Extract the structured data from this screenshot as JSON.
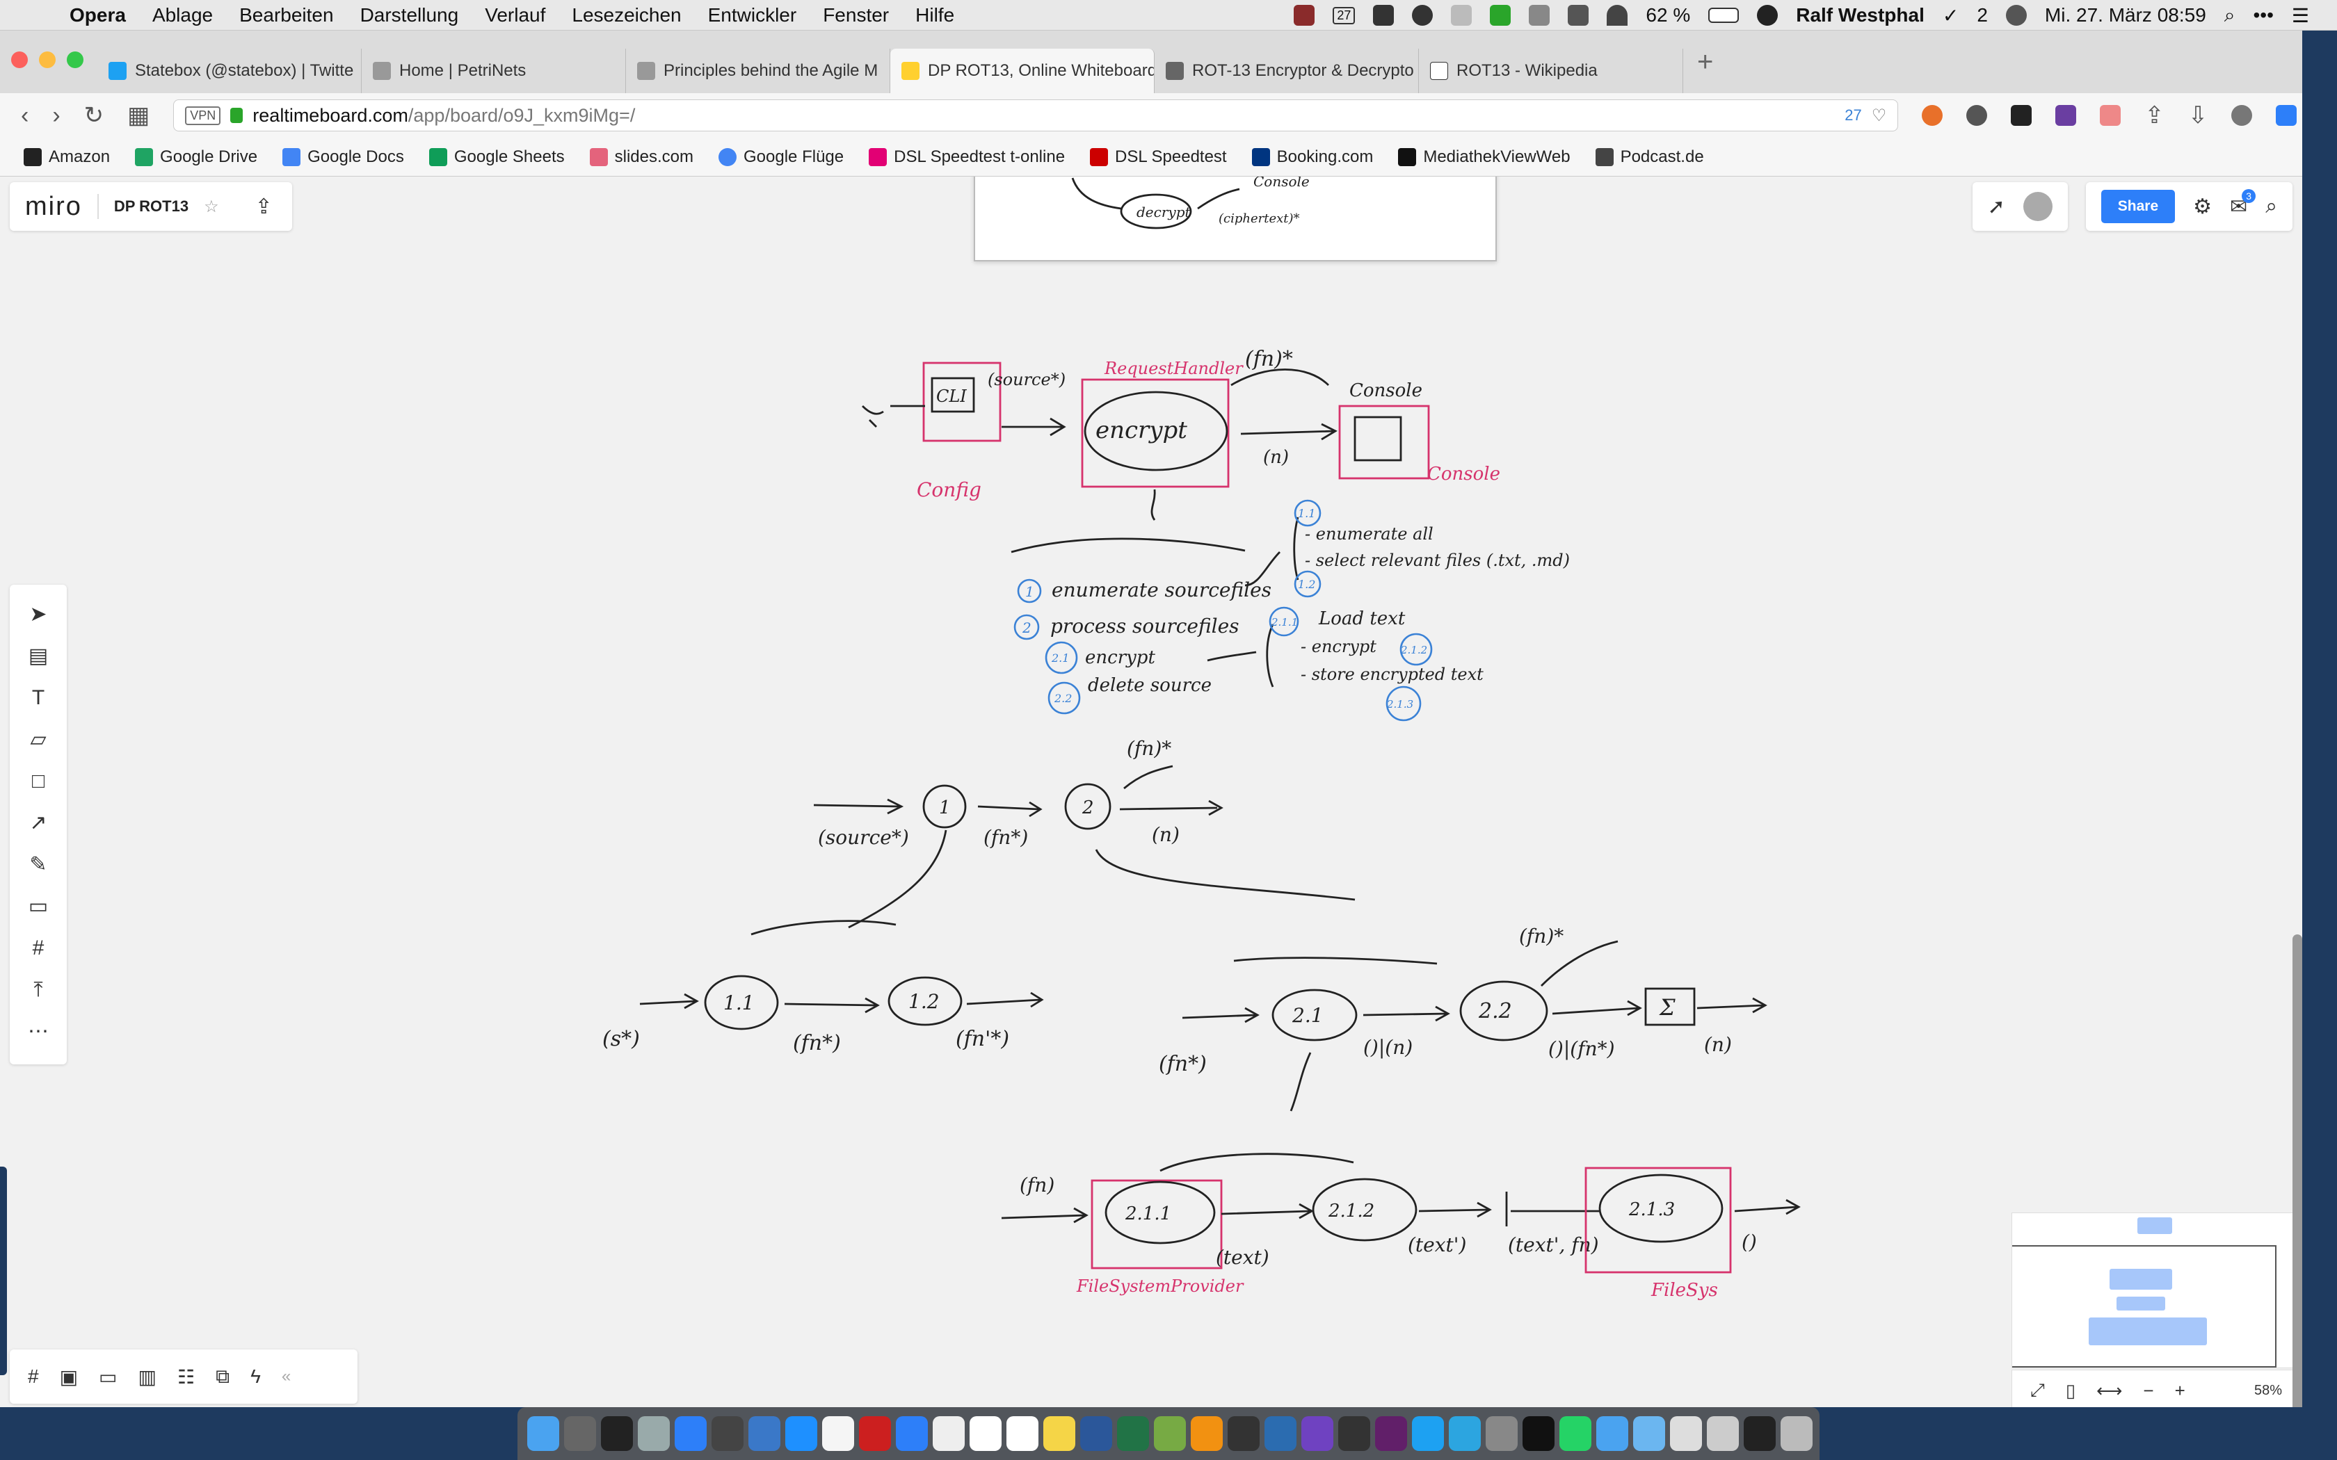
{
  "menubar": {
    "apple": "",
    "app": "Opera",
    "items": [
      "Ablage",
      "Bearbeiten",
      "Darstellung",
      "Verlauf",
      "Lesezeichen",
      "Entwickler",
      "Fenster",
      "Hilfe"
    ],
    "calendar_day": "27",
    "battery": "62 %",
    "user": "Ralf Westphal",
    "tasks_count": "2",
    "datetime": "Mi. 27. März  08:59"
  },
  "tabs": [
    {
      "label": "Statebox (@statebox) | Twitte",
      "color": "#1da1f2"
    },
    {
      "label": "Home | PetriNets",
      "color": "#888888"
    },
    {
      "label": "Principles behind the Agile M",
      "color": "#888888"
    },
    {
      "label": "DP ROT13, Online Whiteboard",
      "color": "#ffd02f"
    },
    {
      "label": "ROT-13 Encryptor & Decrypto",
      "color": "#666666"
    },
    {
      "label": "ROT13 - Wikipedia",
      "color": "#333333"
    }
  ],
  "address": {
    "vpn": "VPN",
    "host": "realtimeboard.com",
    "path": "/app/board/o9J_kxm9iMg=/",
    "badge_count": "27"
  },
  "bookmarks": [
    {
      "label": "Amazon",
      "color": "#222222"
    },
    {
      "label": "Google Drive",
      "color": "#1fa463"
    },
    {
      "label": "Google Docs",
      "color": "#4285f4"
    },
    {
      "label": "Google Sheets",
      "color": "#0f9d58"
    },
    {
      "label": "slides.com",
      "color": "#e4637c"
    },
    {
      "label": "Google Flüge",
      "color": "#4285f4"
    },
    {
      "label": "DSL Speedtest t-online",
      "color": "#e20074"
    },
    {
      "label": "DSL Speedtest",
      "color": "#cc0000"
    },
    {
      "label": "Booking.com",
      "color": "#003580"
    },
    {
      "label": "MediathekViewWeb",
      "color": "#111111"
    },
    {
      "label": "Podcast.de",
      "color": "#444444"
    }
  ],
  "miro": {
    "logo": "miro",
    "board_name": "DP ROT13",
    "share": "Share",
    "notif_count": "3",
    "zoom": "58%",
    "accent": "#2d7ff9"
  },
  "sketch": {
    "top_frame": [
      "decrypt",
      "Console",
      "(ciphertext)*"
    ],
    "diagram1": {
      "source": "(source*)",
      "request_handler": "RequestHandler",
      "fn": "(fn)*",
      "console_top": "Console",
      "cli": "CLI",
      "encrypt": "encrypt",
      "n": "(n)",
      "console_right": "Console",
      "config": "Config"
    },
    "steps": {
      "s1": "1",
      "s1_text": "enumerate sourcefiles",
      "s11": "1.1",
      "s11_text": "- enumerate all",
      "s12_text": "- select relevant files (.txt, .md)",
      "s12": "1.2",
      "s2": "2",
      "s2_text": "process sourcefiles",
      "s21": "2.1",
      "s21_text": "encrypt",
      "s22": "2.2",
      "s22_text": "delete source",
      "s211": "2.1.1",
      "s211_text": "Load text",
      "s212_text": "- encrypt",
      "s212": "2.1.2",
      "s213_text": "- store encrypted text",
      "s213": "2.1.3"
    },
    "diagram2": {
      "source": "(source*)",
      "n1": "1",
      "fn": "(fn*)",
      "n2": "2",
      "fn_out": "(fn)*",
      "n_out": "(n)"
    },
    "diagram3": {
      "s": "(s*)",
      "n11": "1.1",
      "fn": "(fn*)",
      "n12": "1.2",
      "fn2": "(fn'*)"
    },
    "diagram4": {
      "fn_in": "(fn*)",
      "n21": "2.1",
      "out1": "()|(n)",
      "n22": "2.2",
      "fn_up": "(fn)*",
      "out2": "()|(fn*)",
      "sigma": "Σ",
      "n_out": "(n)"
    },
    "diagram5": {
      "fn": "(fn)",
      "n211": "2.1.1",
      "text": "(text)",
      "n212": "2.1.2",
      "text2": "(text')",
      "text_fn": "(text', fn)",
      "n213": "2.1.3",
      "out": "()",
      "fsp": "FileSystemProvider",
      "fs": "FileSys"
    }
  }
}
